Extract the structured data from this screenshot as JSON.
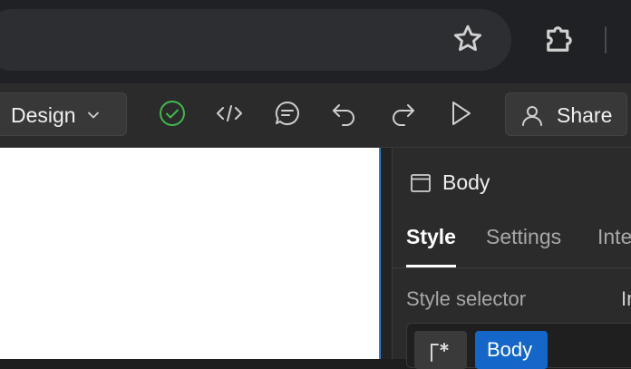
{
  "browser": {
    "bookmark_icon": "star-icon",
    "extensions_icon": "puzzle-icon"
  },
  "toolbar": {
    "mode_label": "Design",
    "icons": [
      "check-circle-icon",
      "code-icon",
      "comment-icon",
      "undo-icon",
      "redo-icon",
      "play-icon"
    ],
    "share_label": "Share",
    "status_color": "#3fb950"
  },
  "panel": {
    "element_name": "Body",
    "tabs": [
      "Style",
      "Settings",
      "Inte"
    ],
    "selector_label": "Style selector",
    "selector_extra": "Ir",
    "selector_chip": "Body",
    "accent_color": "#1466c9"
  }
}
